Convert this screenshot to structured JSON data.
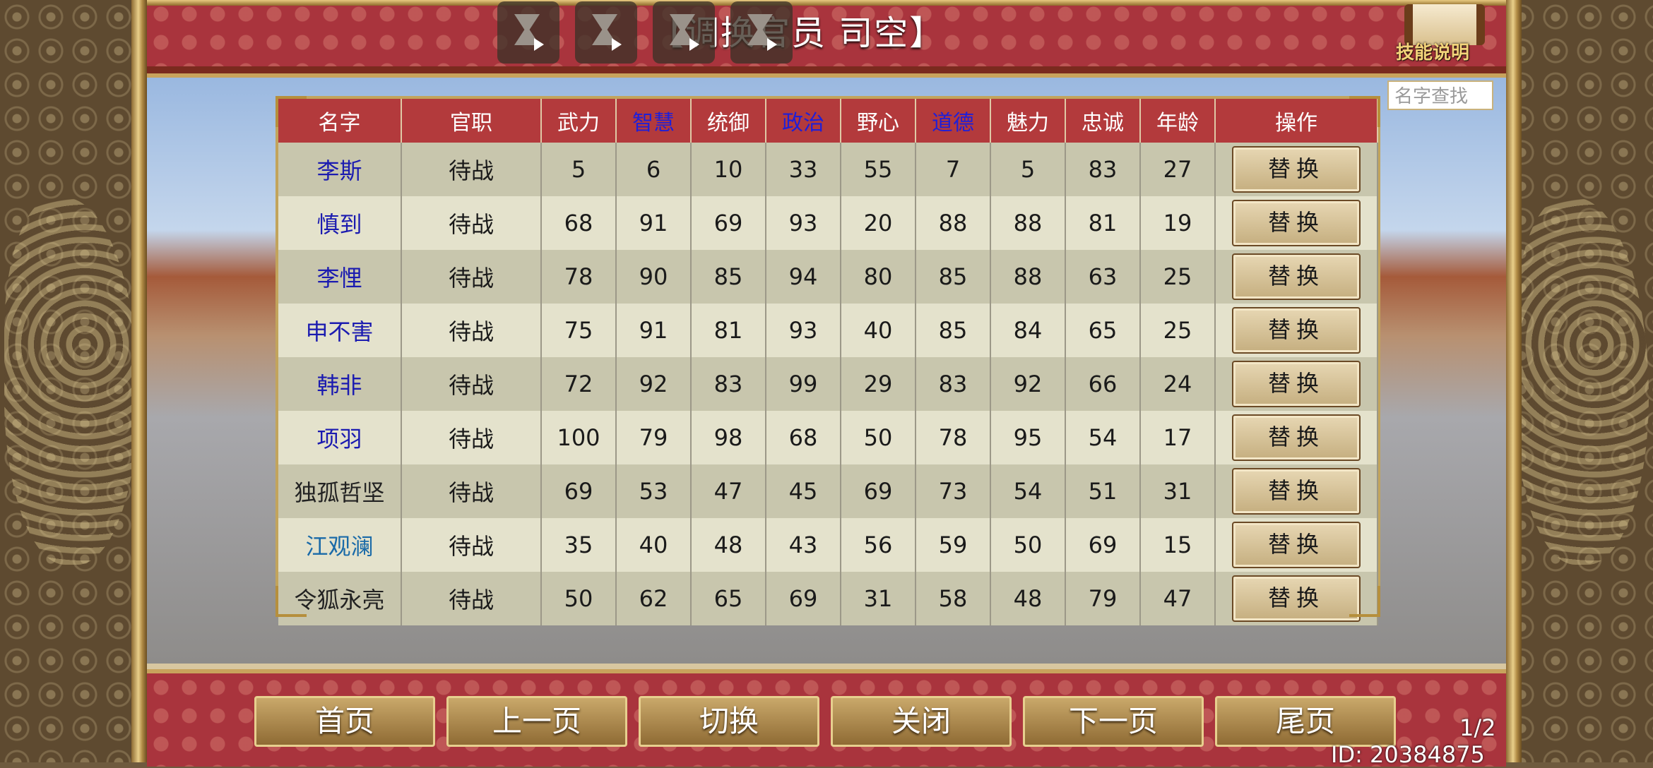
{
  "header": {
    "title": "【调换官员 司空】",
    "skill_label": "技能说明"
  },
  "search": {
    "placeholder": "名字查找"
  },
  "table": {
    "columns": [
      "名字",
      "官职",
      "武力",
      "智慧",
      "统御",
      "政治",
      "野心",
      "道德",
      "魅力",
      "忠诚",
      "年龄",
      "操作"
    ],
    "rows": [
      {
        "name": "李斯",
        "post": "待战",
        "wuli": "5",
        "zhihui": "6",
        "tongyu": "10",
        "zhengzhi": "33",
        "yexin": "55",
        "daode": "7",
        "meili": "5",
        "zhongcheng": "83",
        "age": "27",
        "action": "替换"
      },
      {
        "name": "慎到",
        "post": "待战",
        "wuli": "68",
        "zhihui": "91",
        "tongyu": "69",
        "zhengzhi": "93",
        "yexin": "20",
        "daode": "88",
        "meili": "88",
        "zhongcheng": "81",
        "age": "19",
        "action": "替换"
      },
      {
        "name": "李悝",
        "post": "待战",
        "wuli": "78",
        "zhihui": "90",
        "tongyu": "85",
        "zhengzhi": "94",
        "yexin": "80",
        "daode": "85",
        "meili": "88",
        "zhongcheng": "63",
        "age": "25",
        "action": "替换"
      },
      {
        "name": "申不害",
        "post": "待战",
        "wuli": "75",
        "zhihui": "91",
        "tongyu": "81",
        "zhengzhi": "93",
        "yexin": "40",
        "daode": "85",
        "meili": "84",
        "zhongcheng": "65",
        "age": "25",
        "action": "替换"
      },
      {
        "name": "韩非",
        "post": "待战",
        "wuli": "72",
        "zhihui": "92",
        "tongyu": "83",
        "zhengzhi": "99",
        "yexin": "29",
        "daode": "83",
        "meili": "92",
        "zhongcheng": "66",
        "age": "24",
        "action": "替换"
      },
      {
        "name": "项羽",
        "post": "待战",
        "wuli": "100",
        "zhihui": "79",
        "tongyu": "98",
        "zhengzhi": "68",
        "yexin": "50",
        "daode": "78",
        "meili": "95",
        "zhongcheng": "54",
        "age": "17",
        "action": "替换"
      },
      {
        "name": "独孤哲坚",
        "post": "待战",
        "wuli": "69",
        "zhihui": "53",
        "tongyu": "47",
        "zhengzhi": "45",
        "yexin": "69",
        "daode": "73",
        "meili": "54",
        "zhongcheng": "51",
        "age": "31",
        "action": "替换"
      },
      {
        "name": "江观澜",
        "post": "待战",
        "wuli": "35",
        "zhihui": "40",
        "tongyu": "48",
        "zhengzhi": "43",
        "yexin": "56",
        "daode": "59",
        "meili": "50",
        "zhongcheng": "69",
        "age": "15",
        "action": "替换"
      },
      {
        "name": "令狐永亮",
        "post": "待战",
        "wuli": "50",
        "zhihui": "62",
        "tongyu": "65",
        "zhengzhi": "69",
        "yexin": "31",
        "daode": "58",
        "meili": "48",
        "zhongcheng": "79",
        "age": "47",
        "action": "替换"
      }
    ]
  },
  "nav": {
    "first": "首页",
    "prev": "上一页",
    "switch": "切换",
    "close": "关闭",
    "next": "下一页",
    "last": "尾页"
  },
  "page_indicator": "1/2",
  "player_id": "ID: 20384875",
  "colors": {
    "header_red": "#b33a3c",
    "name_blue": "#1b1bb0",
    "name_teal": "#1a6aa8",
    "gold": "#c8a35c"
  }
}
